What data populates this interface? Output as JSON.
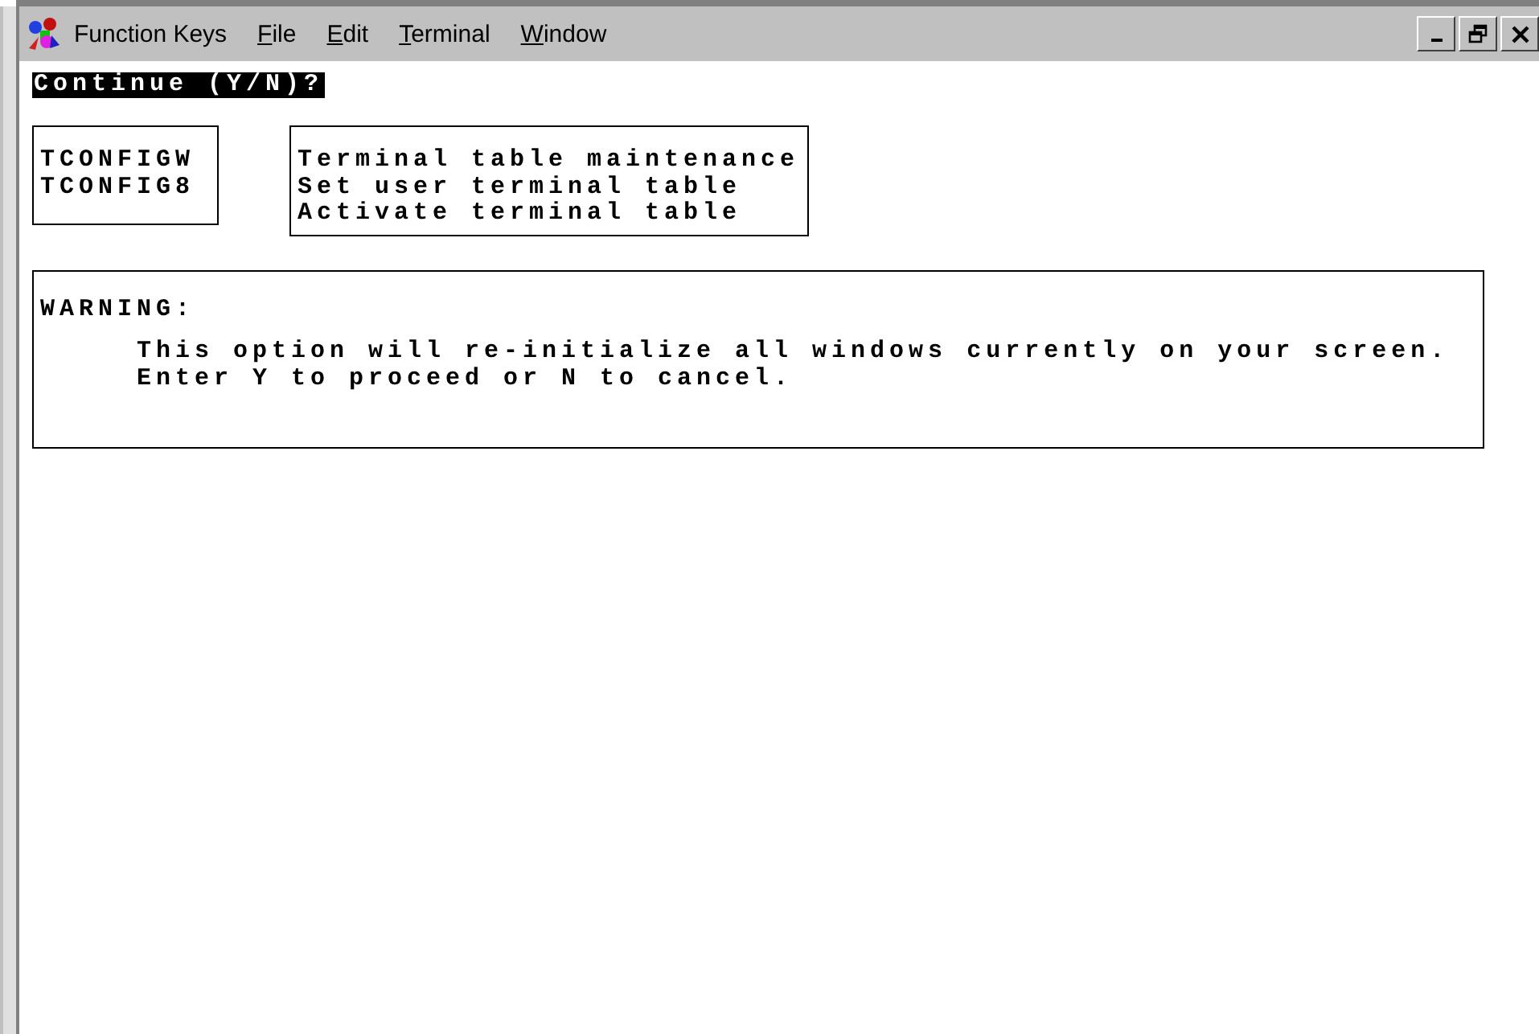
{
  "menu_bar": {
    "items": [
      {
        "label": "Function Keys",
        "mnemonic_underlined": false
      },
      {
        "label": "File",
        "mnemonic_underlined": true
      },
      {
        "label": "Edit",
        "mnemonic_underlined": true
      },
      {
        "label": "Terminal",
        "mnemonic_underlined": true
      },
      {
        "label": "Window",
        "mnemonic_underlined": true
      }
    ]
  },
  "prompt": "Continue (Y/N)?",
  "program_codes": [
    "TCONFIGW",
    "TCONFIG8"
  ],
  "program_descriptions": [
    "Terminal table maintenance",
    "Set user terminal table",
    "Activate terminal table"
  ],
  "warning": {
    "title": "WARNING:",
    "lines": [
      "This option will re-initialize all windows currently on your screen.",
      "Enter Y to proceed or N to cancel."
    ]
  }
}
